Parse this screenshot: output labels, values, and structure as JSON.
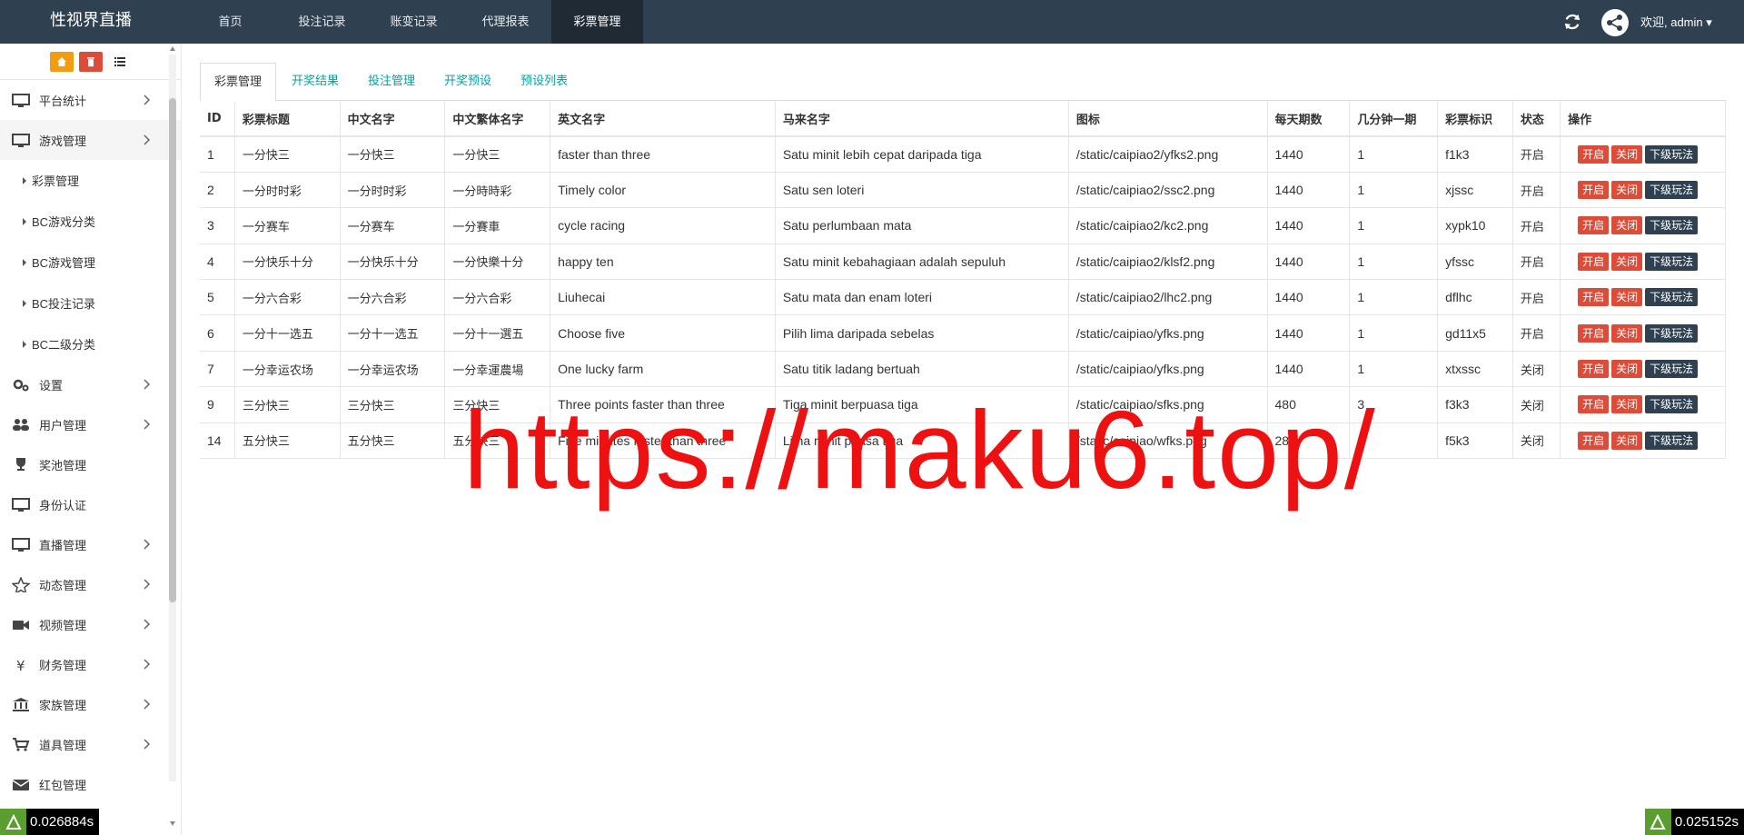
{
  "brand": "性视界直播",
  "topnav": [
    {
      "label": "首页",
      "active": false
    },
    {
      "label": "投注记录",
      "active": false
    },
    {
      "label": "账变记录",
      "active": false
    },
    {
      "label": "代理报表",
      "active": false
    },
    {
      "label": "彩票管理",
      "active": true
    }
  ],
  "user": {
    "welcome": "欢迎, admin ▾"
  },
  "sidebar": {
    "items": [
      {
        "label": "平台统计",
        "icon": "monitor-icon",
        "arrow": true
      },
      {
        "label": "游戏管理",
        "icon": "monitor-icon",
        "arrow": true,
        "active": true
      },
      {
        "label": "彩票管理",
        "sub": true
      },
      {
        "label": "BC游戏分类",
        "sub": true
      },
      {
        "label": "BC游戏管理",
        "sub": true
      },
      {
        "label": "BC投注记录",
        "sub": true
      },
      {
        "label": "BC二级分类",
        "sub": true
      },
      {
        "label": "设置",
        "icon": "gears-icon",
        "arrow": true
      },
      {
        "label": "用户管理",
        "icon": "users-icon",
        "arrow": true
      },
      {
        "label": "奖池管理",
        "icon": "trophy-icon",
        "arrow": false
      },
      {
        "label": "身份认证",
        "icon": "monitor-icon",
        "arrow": false
      },
      {
        "label": "直播管理",
        "icon": "monitor-icon",
        "arrow": true
      },
      {
        "label": "动态管理",
        "icon": "star-icon",
        "arrow": true
      },
      {
        "label": "视频管理",
        "icon": "video-icon",
        "arrow": true
      },
      {
        "label": "财务管理",
        "icon": "yen-icon",
        "arrow": true
      },
      {
        "label": "家族管理",
        "icon": "bank-icon",
        "arrow": true
      },
      {
        "label": "道具管理",
        "icon": "cart-icon",
        "arrow": true
      },
      {
        "label": "红包管理",
        "icon": "envelope-icon",
        "arrow": false
      }
    ]
  },
  "tabs": [
    {
      "label": "彩票管理",
      "active": true
    },
    {
      "label": "开奖结果",
      "active": false
    },
    {
      "label": "投注管理",
      "active": false
    },
    {
      "label": "开奖预设",
      "active": false
    },
    {
      "label": "预设列表",
      "active": false
    }
  ],
  "table": {
    "headers": [
      "ID",
      "彩票标题",
      "中文名字",
      "中文繁体名字",
      "英文名字",
      "马来名字",
      "图标",
      "每天期数",
      "几分钟一期",
      "彩票标识",
      "状态",
      "操作"
    ],
    "rows": [
      [
        "1",
        "一分快三",
        "一分快三",
        "一分快三",
        "faster than three",
        "Satu minit lebih cepat daripada tiga",
        "/static/caipiao2/yfks2.png",
        "1440",
        "1",
        "f1k3",
        "开启"
      ],
      [
        "2",
        "一分时时彩",
        "一分时时彩",
        "一分時時彩",
        "Timely color",
        "Satu sen loteri",
        "/static/caipiao2/ssc2.png",
        "1440",
        "1",
        "xjssc",
        "开启"
      ],
      [
        "3",
        "一分赛车",
        "一分赛车",
        "一分賽車",
        "cycle racing",
        "Satu perlumbaan mata",
        "/static/caipiao2/kc2.png",
        "1440",
        "1",
        "xypk10",
        "开启"
      ],
      [
        "4",
        "一分快乐十分",
        "一分快乐十分",
        "一分快樂十分",
        "happy ten",
        "Satu minit kebahagiaan adalah sepuluh",
        "/static/caipiao2/klsf2.png",
        "1440",
        "1",
        "yfssc",
        "开启"
      ],
      [
        "5",
        "一分六合彩",
        "一分六合彩",
        "一分六合彩",
        "Liuhecai",
        "Satu mata dan enam loteri",
        "/static/caipiao2/lhc2.png",
        "1440",
        "1",
        "dflhc",
        "开启"
      ],
      [
        "6",
        "一分十一选五",
        "一分十一选五",
        "一分十一選五",
        "Choose five",
        "Pilih lima daripada sebelas",
        "/static/caipiao/yfks.png",
        "1440",
        "1",
        "gd11x5",
        "开启"
      ],
      [
        "7",
        "一分幸运农场",
        "一分幸运农场",
        "一分幸運農場",
        "One lucky farm",
        "Satu titik ladang bertuah",
        "/static/caipiao/yfks.png",
        "1440",
        "1",
        "xtxssc",
        "关闭"
      ],
      [
        "9",
        "三分快三",
        "三分快三",
        "三分快三",
        "Three points faster than three",
        "Tiga minit berpuasa tiga",
        "/static/caipiao/sfks.png",
        "480",
        "3",
        "f3k3",
        "关闭"
      ],
      [
        "14",
        "五分快三",
        "五分快三",
        "五分快三",
        "Five minutes faster than three",
        "Lima minit puasa tiga",
        "/static/caipiao/wfks.png",
        "288",
        "5",
        "f5k3",
        "关闭"
      ]
    ],
    "actions": {
      "open": "开启",
      "close": "关闭",
      "sub": "下级玩法"
    }
  },
  "watermark": "https://maku6.top/",
  "timers": {
    "left": "0.026884s",
    "right": "0.025152s"
  },
  "colors": {
    "topbar": "#2f4050",
    "accent": "#00a2a2",
    "danger": "#dd4b39",
    "watermark": "#ee1111"
  }
}
